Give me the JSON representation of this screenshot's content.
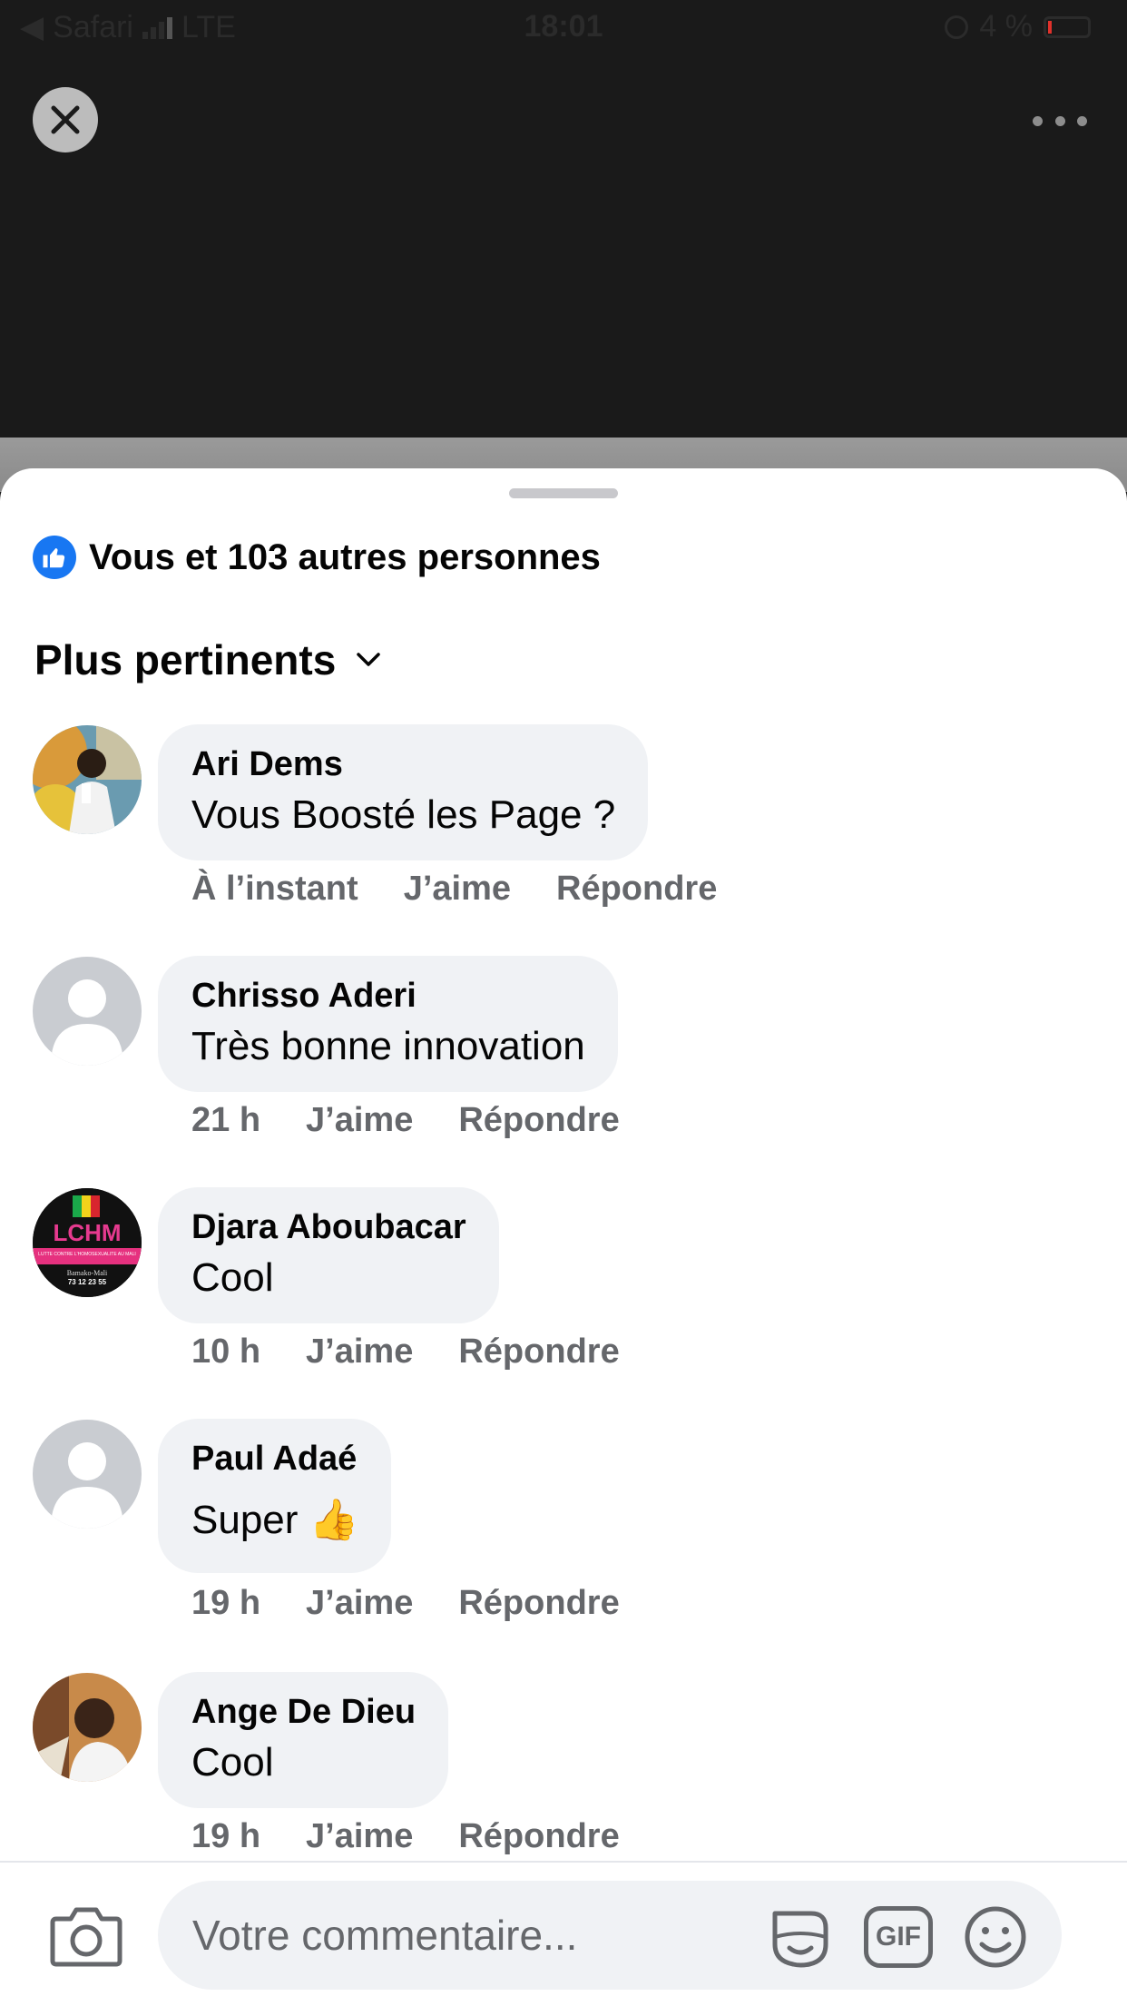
{
  "status_bar": {
    "back_app": "Safari",
    "network": "LTE",
    "time": "18:01",
    "battery": "4 %"
  },
  "reactions": {
    "summary": "Vous et 103 autres personnes"
  },
  "sort": {
    "label": "Plus pertinents"
  },
  "comments": [
    {
      "author": "Ari Dems",
      "text": "Vous  Boosté les Page ?",
      "time": "À l’instant",
      "like": "J’aime",
      "reply": "Répondre"
    },
    {
      "author": "Chrisso Aderi",
      "text": "Très bonne innovation",
      "time": "21 h",
      "like": "J’aime",
      "reply": "Répondre"
    },
    {
      "author": "Djara Aboubacar",
      "text": "Cool",
      "time": "10 h",
      "like": "J’aime",
      "reply": "Répondre"
    },
    {
      "author": "Paul Adaé",
      "text": "Super 👍",
      "time": "19 h",
      "like": "J’aime",
      "reply": "Répondre"
    },
    {
      "author": "Ange De Dieu",
      "text": "Cool",
      "time": "19 h",
      "like": "J’aime",
      "reply": "Répondre"
    }
  ],
  "avatar_logo": {
    "line1": "LCHM",
    "line2": "LUTTE CONTRE L'HOMOSEXUALITE AU MALI",
    "line3": "Bamako-Mali",
    "line4": "73 12 23 55"
  },
  "composer": {
    "placeholder": "Votre commentaire...",
    "gif_label": "GIF"
  },
  "colors": {
    "accent": "#1877f2",
    "bubble": "#f0f2f5",
    "meta_text": "#65676b"
  },
  "icons": [
    "back-arrow-icon",
    "signal-icon",
    "rotation-lock-icon",
    "battery-icon",
    "close-icon",
    "more-icon",
    "thumbs-up-icon",
    "chevron-down-icon",
    "camera-icon",
    "sticker-icon",
    "gif-icon",
    "emoji-icon"
  ]
}
